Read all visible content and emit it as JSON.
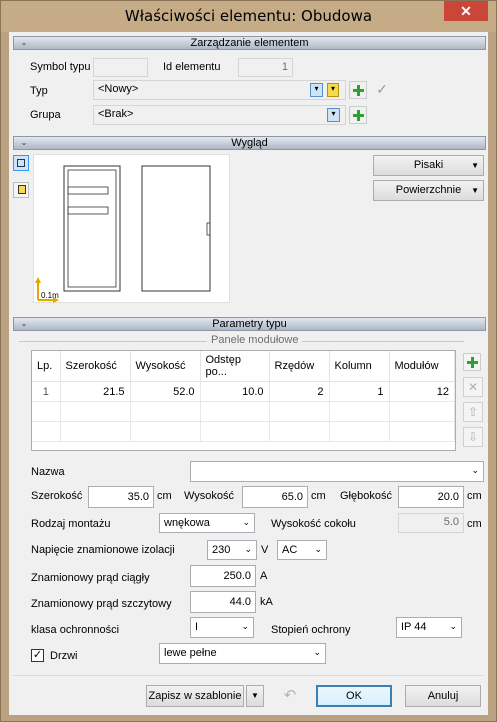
{
  "window": {
    "title": "Właściwości elementu: Obudowa",
    "close": "✕"
  },
  "section_manage": {
    "header": "Zarządzanie elementem",
    "symbol_label": "Symbol typu",
    "symbol_value": "",
    "id_label": "Id elementu",
    "id_value": "1",
    "typ_label": "Typ",
    "typ_value": "<Nowy>",
    "grupa_label": "Grupa",
    "grupa_value": "<Brak>"
  },
  "section_view": {
    "header": "Wygląd",
    "pisaki": "Pisaki",
    "powierzchnie": "Powierzchnie",
    "scale_label": "0.1m"
  },
  "section_params": {
    "header": "Parametry typu",
    "panels_title": "Panele modułowe",
    "columns": [
      "Lp.",
      "Szerokość",
      "Wysokość",
      "Odstęp po...",
      "Rzędów",
      "Kolumn",
      "Modułów"
    ],
    "rows": [
      [
        "1",
        "21.5",
        "52.0",
        "10.0",
        "2",
        "1",
        "12"
      ]
    ]
  },
  "form": {
    "nazwa_label": "Nazwa",
    "nazwa_value": "",
    "szer_label": "Szerokość",
    "szer_value": "35.0",
    "szer_unit": "cm",
    "wys_label": "Wysokość",
    "wys_value": "65.0",
    "wys_unit": "cm",
    "gleb_label": "Głębokość",
    "gleb_value": "20.0",
    "gleb_unit": "cm",
    "montaz_label": "Rodzaj montażu",
    "montaz_value": "wnękowa",
    "cokol_label": "Wysokość cokołu",
    "cokol_value": "5.0",
    "cokol_unit": "cm",
    "napiecie_label": "Napięcie znamionowe izolacji",
    "napiecie_value": "230",
    "napiecie_unit": "V",
    "napiecie_type": "AC",
    "prad_ciagly_label": "Znamionowy prąd ciągły",
    "prad_ciagly_value": "250.0",
    "prad_ciagly_unit": "A",
    "prad_szczyt_label": "Znamionowy prąd szczytowy",
    "prad_szczyt_value": "44.0",
    "prad_szczyt_unit": "kA",
    "klasa_label": "klasa ochronności",
    "klasa_value": "I",
    "stopien_label": "Stopień ochrony",
    "stopien_value": "IP 44",
    "drzwi_label": "Drzwi",
    "drzwi_value": "lewe pełne"
  },
  "footer": {
    "save_template": "Zapisz w szablonie",
    "ok": "OK",
    "cancel": "Anuluj"
  }
}
